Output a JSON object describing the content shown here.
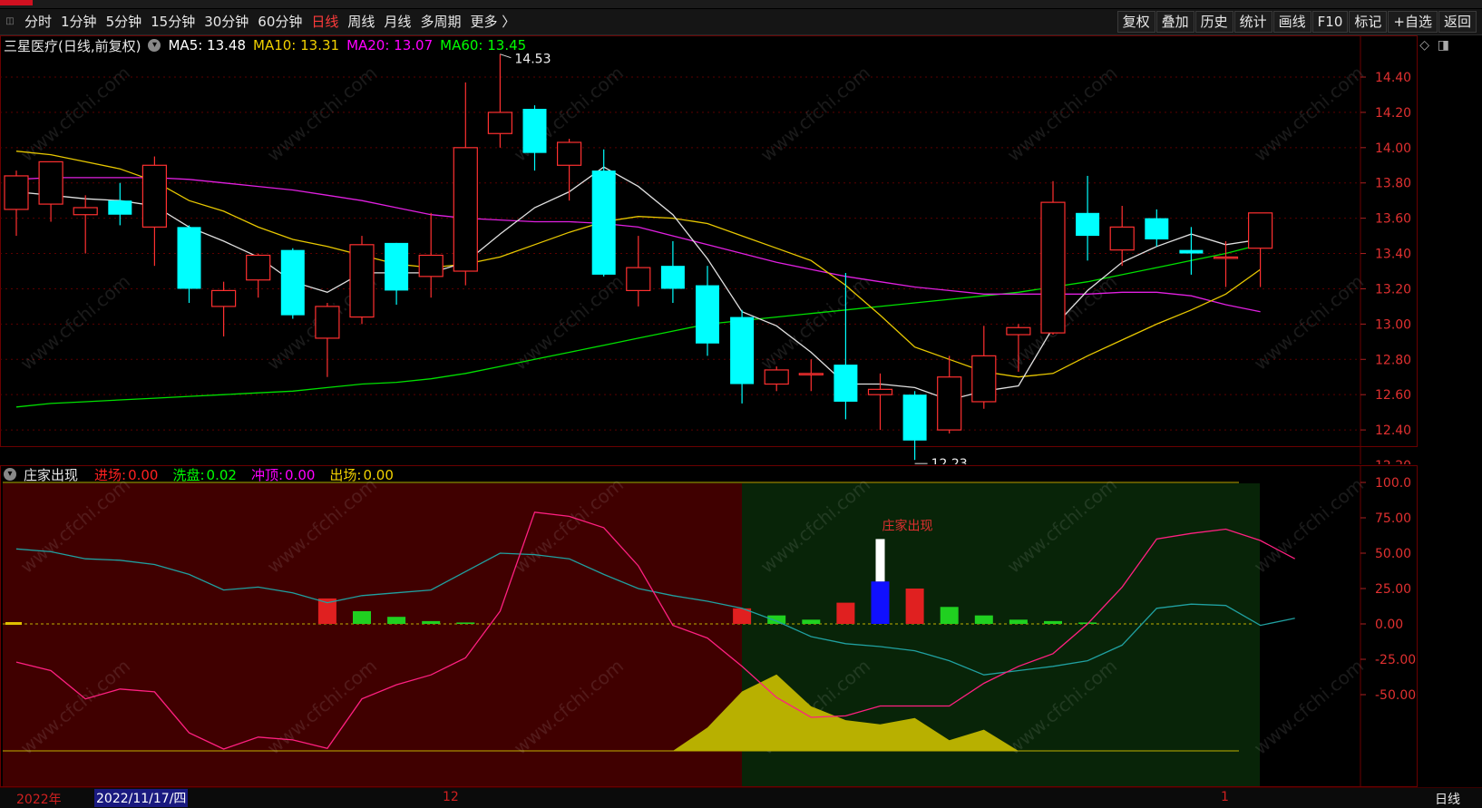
{
  "toolbar": {
    "periods": [
      "分时",
      "1分钟",
      "5分钟",
      "15分钟",
      "30分钟",
      "60分钟",
      "日线",
      "周线",
      "月线",
      "多周期",
      "更多 〉"
    ],
    "active_period": "日线",
    "right_buttons": [
      "复权",
      "叠加",
      "历史",
      "统计",
      "画线",
      "F10",
      "标记",
      "+自选",
      "返回"
    ]
  },
  "main": {
    "title": "三星医疗(日线,前复权)",
    "ma_labels": [
      {
        "text": "MA5: 13.48",
        "color": "#ffffff"
      },
      {
        "text": "MA10: 13.31",
        "color": "#f0d000"
      },
      {
        "text": "MA20: 13.07",
        "color": "#ff00ff"
      },
      {
        "text": "MA60: 13.45",
        "color": "#00ff00"
      }
    ],
    "price_ticks": [
      "14.40",
      "14.20",
      "14.00",
      "13.80",
      "13.60",
      "13.40",
      "13.20",
      "13.00",
      "12.80",
      "12.60",
      "12.40",
      "12.20"
    ],
    "high_marker": "14.53",
    "low_marker": "12.23"
  },
  "sub": {
    "title": "庄家出现",
    "legend": [
      {
        "label": "进场:",
        "value": "0.00",
        "color": "#ff2020"
      },
      {
        "label": "洗盘:",
        "value": "0.02",
        "color": "#00ff00"
      },
      {
        "label": "冲顶:",
        "value": "0.00",
        "color": "#ff00ff"
      },
      {
        "label": "出场:",
        "value": "0.00",
        "color": "#f0d000"
      }
    ],
    "ticks": [
      "100.0",
      "75.00",
      "50.00",
      "25.00",
      "0.00",
      "-25.00",
      "-50.00"
    ],
    "signal_label": "庄家出现"
  },
  "bottom": {
    "year_label": "2022年",
    "cursor_date": "2022/11/17/四",
    "month_labels": [
      "12",
      "1"
    ],
    "period_label": "日线"
  },
  "watermark": "www.cfchi.com",
  "chart_data": {
    "type": "candlestick",
    "candles": [
      {
        "o": 13.65,
        "h": 13.87,
        "l": 13.5,
        "c": 13.84
      },
      {
        "o": 13.68,
        "h": 13.9,
        "l": 13.58,
        "c": 13.92
      },
      {
        "o": 13.62,
        "h": 13.73,
        "l": 13.4,
        "c": 13.66
      },
      {
        "o": 13.7,
        "h": 13.8,
        "l": 13.56,
        "c": 13.62
      },
      {
        "o": 13.55,
        "h": 13.95,
        "l": 13.33,
        "c": 13.9
      },
      {
        "o": 13.55,
        "h": 13.56,
        "l": 13.12,
        "c": 13.2
      },
      {
        "o": 13.1,
        "h": 13.24,
        "l": 12.93,
        "c": 13.19
      },
      {
        "o": 13.25,
        "h": 13.4,
        "l": 13.15,
        "c": 13.39
      },
      {
        "o": 13.42,
        "h": 13.43,
        "l": 13.03,
        "c": 13.05
      },
      {
        "o": 12.92,
        "h": 13.12,
        "l": 12.7,
        "c": 13.1
      },
      {
        "o": 13.04,
        "h": 13.5,
        "l": 13.0,
        "c": 13.45
      },
      {
        "o": 13.46,
        "h": 13.46,
        "l": 13.11,
        "c": 13.19
      },
      {
        "o": 13.27,
        "h": 13.63,
        "l": 13.15,
        "c": 13.39
      },
      {
        "o": 13.3,
        "h": 14.37,
        "l": 13.22,
        "c": 14.0
      },
      {
        "o": 14.08,
        "h": 14.53,
        "l": 14.0,
        "c": 14.2
      },
      {
        "o": 14.22,
        "h": 14.24,
        "l": 13.87,
        "c": 13.97
      },
      {
        "o": 13.9,
        "h": 14.05,
        "l": 13.7,
        "c": 14.03
      },
      {
        "o": 13.87,
        "h": 13.99,
        "l": 13.27,
        "c": 13.28
      },
      {
        "o": 13.19,
        "h": 13.5,
        "l": 13.1,
        "c": 13.32
      },
      {
        "o": 13.33,
        "h": 13.47,
        "l": 13.12,
        "c": 13.2
      },
      {
        "o": 13.22,
        "h": 13.33,
        "l": 12.82,
        "c": 12.89
      },
      {
        "o": 13.04,
        "h": 13.08,
        "l": 12.55,
        "c": 12.66
      },
      {
        "o": 12.66,
        "h": 12.76,
        "l": 12.62,
        "c": 12.74
      },
      {
        "o": 12.72,
        "h": 12.8,
        "l": 12.62,
        "c": 12.72
      },
      {
        "o": 12.77,
        "h": 13.29,
        "l": 12.46,
        "c": 12.56
      },
      {
        "o": 12.6,
        "h": 12.72,
        "l": 12.4,
        "c": 12.63
      },
      {
        "o": 12.6,
        "h": 12.62,
        "l": 12.23,
        "c": 12.34
      },
      {
        "o": 12.4,
        "h": 12.82,
        "l": 12.38,
        "c": 12.7
      },
      {
        "o": 12.56,
        "h": 12.99,
        "l": 12.52,
        "c": 12.82
      },
      {
        "o": 12.94,
        "h": 13.0,
        "l": 12.73,
        "c": 12.98
      },
      {
        "o": 12.95,
        "h": 13.81,
        "l": 12.94,
        "c": 13.69
      },
      {
        "o": 13.63,
        "h": 13.84,
        "l": 13.36,
        "c": 13.5
      },
      {
        "o": 13.42,
        "h": 13.67,
        "l": 13.33,
        "c": 13.55
      },
      {
        "o": 13.6,
        "h": 13.65,
        "l": 13.44,
        "c": 13.48
      },
      {
        "o": 13.42,
        "h": 13.55,
        "l": 13.28,
        "c": 13.4
      },
      {
        "o": 13.38,
        "h": 13.47,
        "l": 13.21,
        "c": 13.38
      },
      {
        "o": 13.43,
        "h": 13.62,
        "l": 13.21,
        "c": 13.63
      }
    ],
    "ma5": [
      13.75,
      13.73,
      13.71,
      13.7,
      13.67,
      13.55,
      13.47,
      13.38,
      13.24,
      13.18,
      13.29,
      13.29,
      13.29,
      13.35,
      13.51,
      13.66,
      13.75,
      13.89,
      13.78,
      13.62,
      13.37,
      13.07,
      12.99,
      12.84,
      12.66,
      12.66,
      12.64,
      12.57,
      12.62,
      12.65,
      12.98,
      13.19,
      13.35,
      13.44,
      13.51,
      13.45,
      13.48
    ],
    "ma10": [
      13.98,
      13.96,
      13.92,
      13.88,
      13.81,
      13.7,
      13.64,
      13.55,
      13.48,
      13.44,
      13.39,
      13.34,
      13.32,
      13.34,
      13.38,
      13.45,
      13.52,
      13.58,
      13.61,
      13.6,
      13.57,
      13.5,
      13.43,
      13.36,
      13.22,
      13.05,
      12.87,
      12.8,
      12.73,
      12.7,
      12.72,
      12.82,
      12.91,
      13.0,
      13.08,
      13.17,
      13.31
    ],
    "ma20": [
      13.82,
      13.83,
      13.83,
      13.83,
      13.83,
      13.82,
      13.8,
      13.78,
      13.76,
      13.73,
      13.7,
      13.66,
      13.62,
      13.6,
      13.59,
      13.58,
      13.58,
      13.57,
      13.55,
      13.5,
      13.45,
      13.4,
      13.35,
      13.31,
      13.27,
      13.24,
      13.21,
      13.19,
      13.17,
      13.17,
      13.17,
      13.17,
      13.18,
      13.18,
      13.16,
      13.11,
      13.07
    ],
    "ma60": [
      12.53,
      12.55,
      12.56,
      12.57,
      12.58,
      12.59,
      12.6,
      12.61,
      12.62,
      12.64,
      12.66,
      12.67,
      12.69,
      12.72,
      12.76,
      12.8,
      12.84,
      12.88,
      12.92,
      12.96,
      13.0,
      13.02,
      13.04,
      13.06,
      13.08,
      13.1,
      13.12,
      13.14,
      13.16,
      13.18,
      13.21,
      13.24,
      13.28,
      13.32,
      13.36,
      13.4,
      13.45
    ],
    "sub": {
      "ylim": [
        -100,
        100
      ],
      "cyan_line": [
        53,
        51,
        46,
        45,
        42,
        35,
        24,
        26,
        22,
        15,
        20,
        22,
        24,
        37,
        50,
        49,
        46,
        35,
        25,
        20,
        16,
        11,
        2,
        -9,
        -14,
        -16,
        -19,
        -26,
        -36,
        -33,
        -30,
        -26,
        -15,
        11,
        14,
        13,
        -1,
        4
      ],
      "pink_line": [
        -27,
        -33,
        -53,
        -46,
        -48,
        -77,
        -95,
        -80,
        -82,
        -88,
        -53,
        -43,
        -36,
        -24,
        9,
        79,
        76,
        68,
        41,
        -1,
        -10,
        -30,
        -52,
        -66,
        -65,
        -58,
        -58,
        -58,
        -42,
        -30,
        -21,
        0,
        26,
        60,
        64,
        67,
        59,
        46
      ],
      "bars": [
        {
          "i": 9,
          "v": 18,
          "color": "#e02020"
        },
        {
          "i": 10,
          "v": 9,
          "color": "#20d020"
        },
        {
          "i": 11,
          "v": 5,
          "color": "#20d020"
        },
        {
          "i": 12,
          "v": 2,
          "color": "#20d020"
        },
        {
          "i": 13,
          "v": 1,
          "color": "#20d020"
        },
        {
          "i": 21,
          "v": 11,
          "color": "#e02020"
        },
        {
          "i": 22,
          "v": 6,
          "color": "#20d020"
        },
        {
          "i": 23,
          "v": 3,
          "color": "#20d020"
        },
        {
          "i": 24,
          "v": 15,
          "color": "#e02020"
        },
        {
          "i": 25,
          "v": 30,
          "color": "#1010ff"
        },
        {
          "i": 26,
          "v": 25,
          "color": "#e02020"
        },
        {
          "i": 27,
          "v": 12,
          "color": "#20d020"
        },
        {
          "i": 28,
          "v": 6,
          "color": "#20d020"
        },
        {
          "i": 29,
          "v": 3,
          "color": "#20d020"
        },
        {
          "i": 30,
          "v": 2,
          "color": "#20d020"
        },
        {
          "i": 31,
          "v": 1,
          "color": "#20d020"
        }
      ],
      "signal_bar": {
        "i": 25,
        "from": 30,
        "to": 60,
        "color": "#ffffff"
      },
      "olive_area": [
        0,
        0,
        0,
        0,
        0,
        0,
        0,
        0,
        0,
        0,
        0,
        0,
        0,
        0,
        0,
        0,
        0,
        0,
        0,
        0,
        22,
        56,
        72,
        42,
        29,
        25,
        31,
        10,
        20,
        0,
        0,
        0,
        0,
        0,
        0,
        0,
        0,
        0
      ]
    }
  }
}
